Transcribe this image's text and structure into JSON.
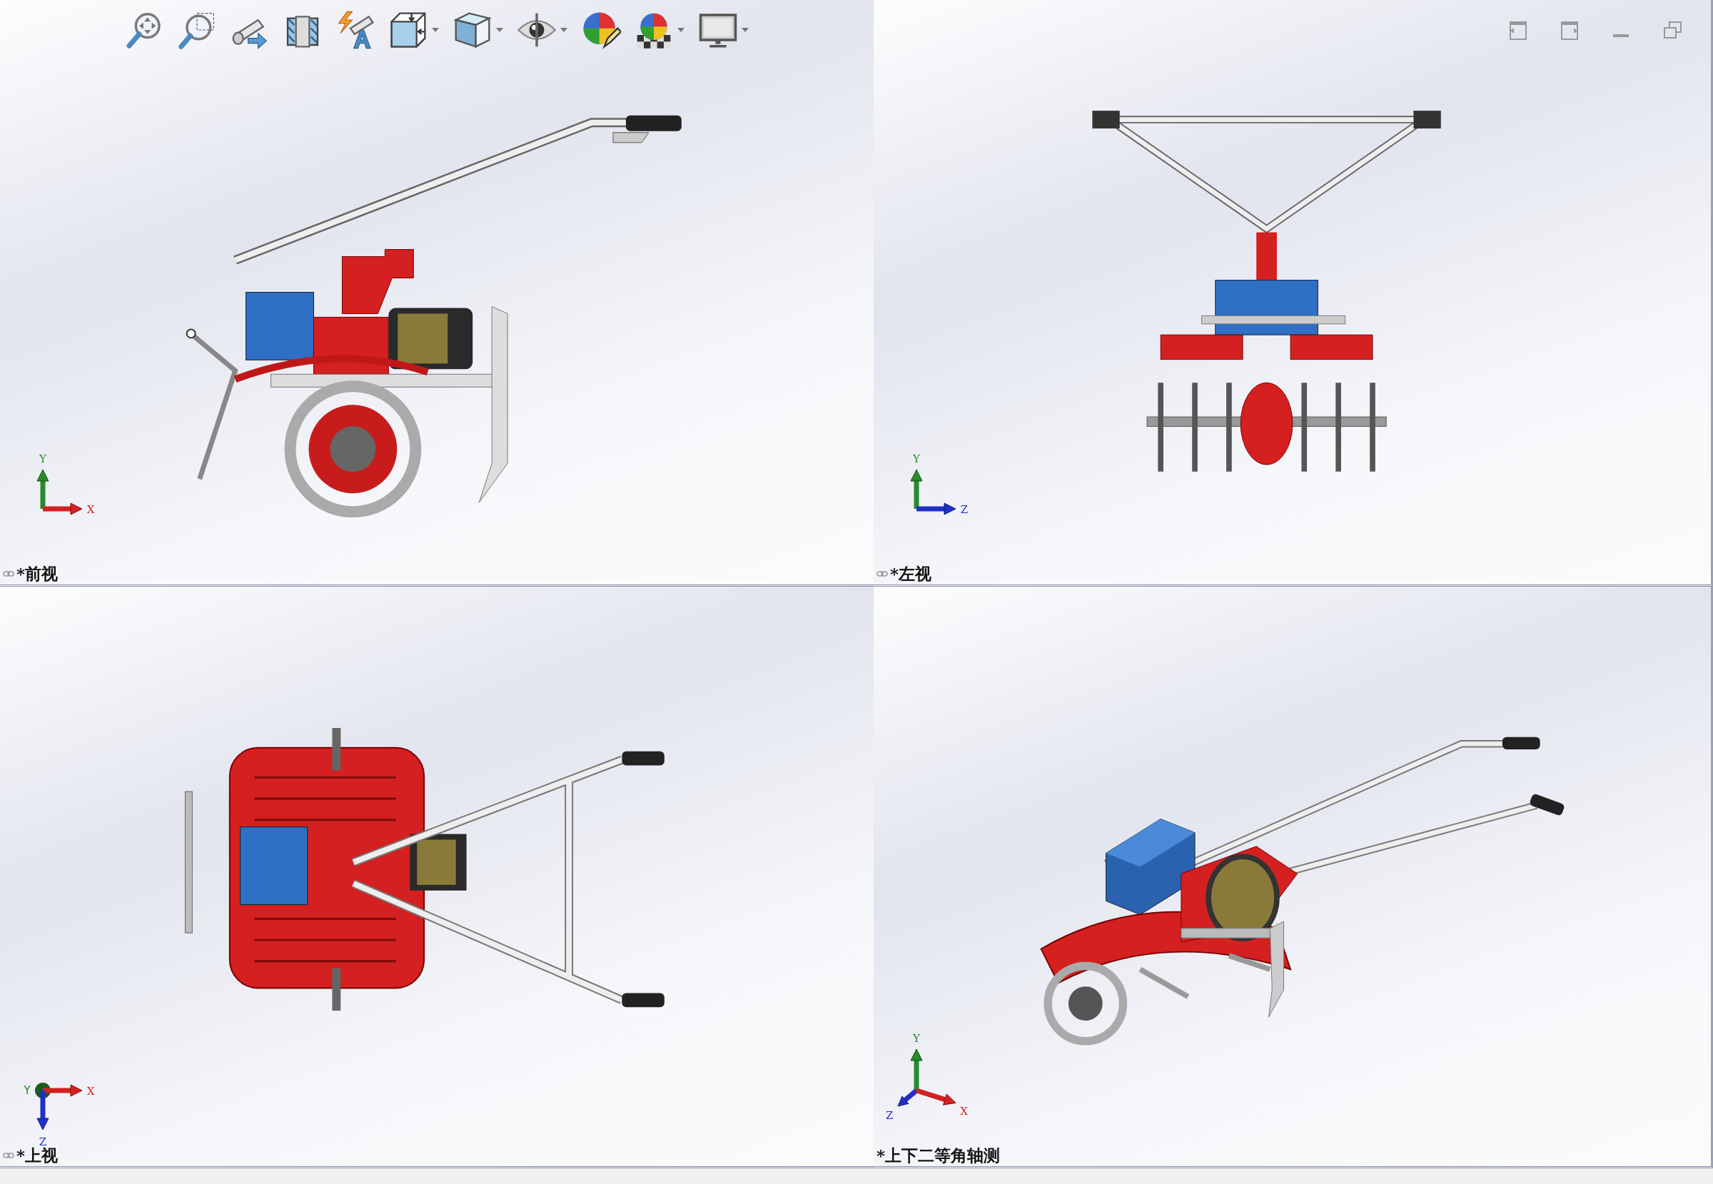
{
  "heads_up_toolbar": [
    {
      "kind": "zoom-to-fit",
      "dropdown": false
    },
    {
      "kind": "zoom-to-area",
      "dropdown": false
    },
    {
      "kind": "previous-view",
      "dropdown": false
    },
    {
      "kind": "section-view",
      "dropdown": false
    },
    {
      "kind": "dynamic-annotation",
      "dropdown": false
    },
    {
      "kind": "view-orientation",
      "dropdown": true
    },
    {
      "kind": "display-style",
      "dropdown": true
    },
    {
      "kind": "hide-show",
      "dropdown": true
    },
    {
      "kind": "edit-appearance",
      "dropdown": false
    },
    {
      "kind": "apply-scene",
      "dropdown": true
    },
    {
      "kind": "view-settings",
      "dropdown": true
    }
  ],
  "viewports": [
    {
      "kind": "front",
      "label": "*前视",
      "linked": true,
      "triad": [
        {
          "kind": "y",
          "label": "Y"
        },
        {
          "kind": "x",
          "label": "X"
        }
      ]
    },
    {
      "kind": "left",
      "label": "*左视",
      "linked": true,
      "triad": [
        {
          "kind": "y",
          "label": "Y"
        },
        {
          "kind": "z",
          "label": "Z"
        }
      ]
    },
    {
      "kind": "top",
      "label": "*上视",
      "linked": true,
      "triad": [
        {
          "kind": "y",
          "label": "Y"
        },
        {
          "kind": "x",
          "label": "X"
        },
        {
          "kind": "z",
          "label": "Z"
        }
      ]
    },
    {
      "kind": "iso",
      "label": "*上下二等角轴测",
      "linked": false,
      "triad": [
        {
          "kind": "y",
          "label": "Y"
        },
        {
          "kind": "z",
          "label": "Z"
        },
        {
          "kind": "x",
          "label": "X"
        }
      ]
    }
  ]
}
